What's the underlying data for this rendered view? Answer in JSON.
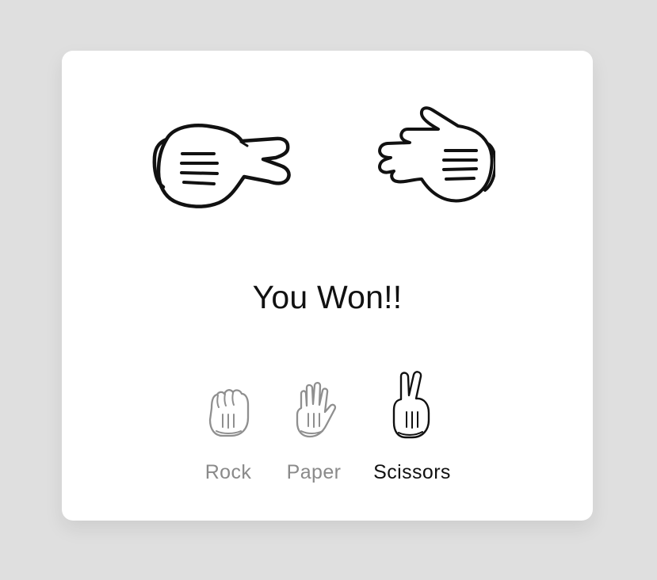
{
  "game": {
    "result_text": "You Won!!",
    "player_move": "Scissors",
    "computer_move": "Paper",
    "selected": "Scissors"
  },
  "choices": [
    {
      "label": "Rock",
      "icon": "rock-hand-icon",
      "state": "inactive"
    },
    {
      "label": "Paper",
      "icon": "paper-hand-icon",
      "state": "inactive"
    },
    {
      "label": "Scissors",
      "icon": "scissors-hand-icon",
      "state": "selected"
    }
  ],
  "colors": {
    "page_background": "#dfdfdf",
    "card_background": "#ffffff",
    "active_text": "#111111",
    "inactive_text": "#8a8a8a"
  }
}
